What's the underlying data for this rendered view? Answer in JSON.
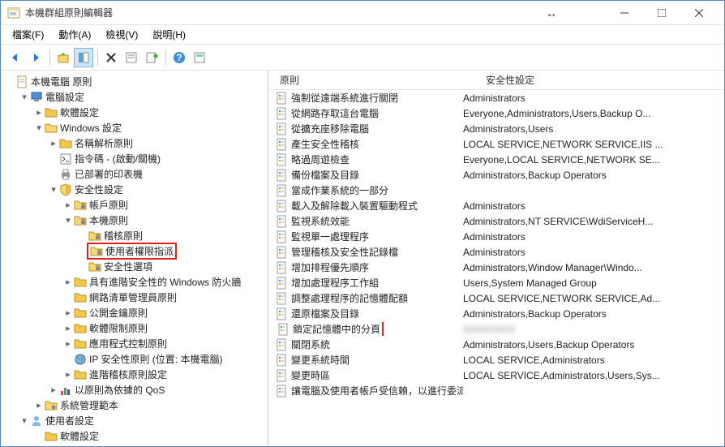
{
  "window": {
    "title": "本機群組原則編輯器"
  },
  "menu": {
    "file": "檔案(F)",
    "action": "動作(A)",
    "view": "檢視(V)",
    "help": "說明(H)"
  },
  "tree": {
    "root": "本機電腦 原則",
    "computer_config": "電腦設定",
    "software_settings": "軟體設定",
    "windows_settings": "Windows 設定",
    "name_resolution": "名稱解析原則",
    "scripts": "指令碼 - (啟動/關機)",
    "deployed_printers": "已部署的印表機",
    "security_settings": "安全性設定",
    "account_policies": "帳戶原則",
    "local_policies": "本機原則",
    "audit_policy": "稽核原則",
    "user_rights": "使用者權限指派",
    "security_options": "安全性選項",
    "firewall": "具有進階安全性的 Windows 防火牆",
    "network_list": "網路清單管理員原則",
    "public_key": "公開金鑰原則",
    "software_restrict": "軟體限制原則",
    "app_control": "應用程式控制原則",
    "ipsec": "IP 安全性原則 (位置: 本機電腦)",
    "advanced_audit": "進階稽核原則設定",
    "qos": "以原則為依據的 QoS",
    "admin_templates": "系統管理範本",
    "user_config": "使用者設定",
    "truncated": "軟體設定"
  },
  "list": {
    "header_name": "原則",
    "header_security": "安全性設定",
    "rows": [
      {
        "name": "強制從遠端系統進行關閉",
        "sec": "Administrators"
      },
      {
        "name": "從網路存取這台電腦",
        "sec": "Everyone,Administrators,Users,Backup O..."
      },
      {
        "name": "從擴充座移除電腦",
        "sec": "Administrators,Users"
      },
      {
        "name": "產生安全性稽核",
        "sec": "LOCAL SERVICE,NETWORK SERVICE,IIS ..."
      },
      {
        "name": "略過周遊檢查",
        "sec": "Everyone,LOCAL SERVICE,NETWORK SE..."
      },
      {
        "name": "備份檔案及目錄",
        "sec": "Administrators,Backup Operators"
      },
      {
        "name": "當成作業系統的一部分",
        "sec": ""
      },
      {
        "name": "載入及解除載入裝置驅動程式",
        "sec": "Administrators"
      },
      {
        "name": "監視系統效能",
        "sec": "Administrators,NT SERVICE\\WdiServiceH..."
      },
      {
        "name": "監視單一處理程序",
        "sec": "Administrators"
      },
      {
        "name": "管理稽核及安全性記錄檔",
        "sec": "Administrators"
      },
      {
        "name": "增加排程優先順序",
        "sec": "Administrators,Window Manager\\Windo..."
      },
      {
        "name": "增加處理程序工作組",
        "sec": "Users,System Managed Group"
      },
      {
        "name": "調整處理程序的記憶體配額",
        "sec": "LOCAL SERVICE,NETWORK SERVICE,Ad..."
      },
      {
        "name": "還原檔案及目錄",
        "sec": "Administrators,Backup Operators"
      },
      {
        "name": "鎖定記憶體中的分頁",
        "sec": "hidden",
        "highlighted": true,
        "blurred": true
      },
      {
        "name": "關閉系統",
        "sec": "Administrators,Users,Backup Operators"
      },
      {
        "name": "變更系統時間",
        "sec": "LOCAL SERVICE,Administrators"
      },
      {
        "name": "變更時區",
        "sec": "LOCAL SERVICE,Administrators,Users,Sys..."
      },
      {
        "name": "讓電腦及使用者帳戶受信賴，以進行委派",
        "sec": ""
      }
    ]
  }
}
